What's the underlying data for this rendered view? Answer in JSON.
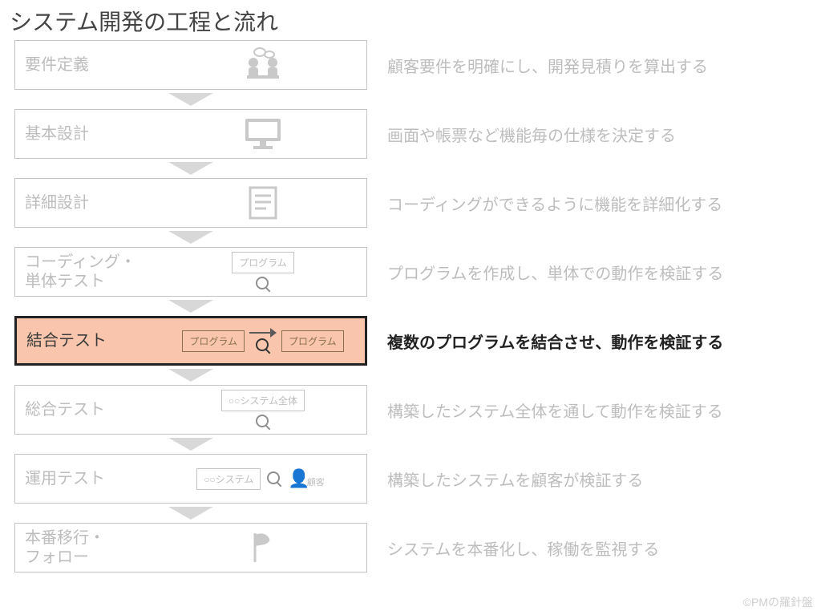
{
  "title": "システム開発の工程と流れ",
  "footer": "©PMの羅針盤",
  "highlight_index": 4,
  "icon_text": {
    "program": "プログラム",
    "system_all": "○○システム全体",
    "system": "○○システム",
    "customer": "顧客"
  },
  "stages": [
    {
      "label": "要件定義",
      "icon": "meeting",
      "desc": "顧客要件を明確にし、開発見積りを算出する"
    },
    {
      "label": "基本設計",
      "icon": "monitor",
      "desc": "画面や帳票など機能毎の仕様を決定する"
    },
    {
      "label": "詳細設計",
      "icon": "document",
      "desc": "コーディングができるように機能を詳細化する"
    },
    {
      "label": "コーディング・\n単体テスト",
      "icon": "program-mag",
      "desc": "プログラムを作成し、単体での動作を検証する"
    },
    {
      "label": "結合テスト",
      "icon": "program-link",
      "desc": "複数のプログラムを結合させ、動作を検証する"
    },
    {
      "label": "総合テスト",
      "icon": "system-all-mag",
      "desc": "構築したシステム全体を通して動作を検証する"
    },
    {
      "label": "運用テスト",
      "icon": "system-customer",
      "desc": "構築したシステムを顧客が検証する"
    },
    {
      "label": "本番移行・\nフォロー",
      "icon": "flag",
      "desc": "システムを本番化し、稼働を監視する"
    }
  ]
}
